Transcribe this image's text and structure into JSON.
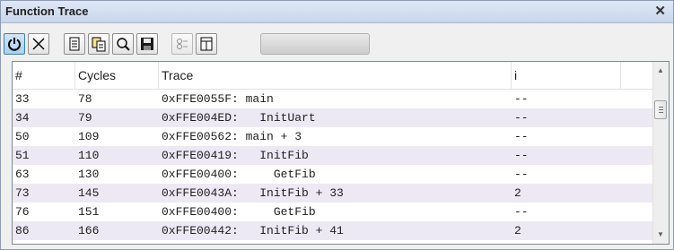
{
  "window": {
    "title": "Function Trace",
    "close_glyph": "✕"
  },
  "toolbar": {
    "buttons": [
      {
        "name": "power-icon",
        "state": "pressed"
      },
      {
        "name": "clear-icon"
      },
      {
        "name": "document-icon"
      },
      {
        "name": "copy-icon"
      },
      {
        "name": "search-icon"
      },
      {
        "name": "save-icon"
      },
      {
        "name": "settings-icon"
      },
      {
        "name": "window-icon"
      }
    ],
    "progress": 0
  },
  "table": {
    "columns": [
      "#",
      "Cycles",
      "Trace",
      "i"
    ],
    "rows": [
      {
        "num": "33",
        "cycles": "78",
        "trace": "0xFFE0055F: main",
        "i": "--"
      },
      {
        "num": "34",
        "cycles": "79",
        "trace": "0xFFE004ED:   InitUart",
        "i": "--"
      },
      {
        "num": "50",
        "cycles": "109",
        "trace": "0xFFE00562: main + 3",
        "i": "--"
      },
      {
        "num": "51",
        "cycles": "110",
        "trace": "0xFFE00419:   InitFib",
        "i": "--"
      },
      {
        "num": "63",
        "cycles": "130",
        "trace": "0xFFE00400:     GetFib",
        "i": "--"
      },
      {
        "num": "73",
        "cycles": "145",
        "trace": "0xFFE0043A:   InitFib + 33",
        "i": "2"
      },
      {
        "num": "76",
        "cycles": "151",
        "trace": "0xFFE00400:     GetFib",
        "i": "--"
      },
      {
        "num": "86",
        "cycles": "166",
        "trace": "0xFFE00442:   InitFib + 41",
        "i": "2"
      }
    ]
  },
  "scrollbar": {
    "up_glyph": "▲",
    "down_glyph": "▼"
  },
  "colors": {
    "alt_row": "#ece9f4",
    "title_bg": "#c9d6ea"
  }
}
